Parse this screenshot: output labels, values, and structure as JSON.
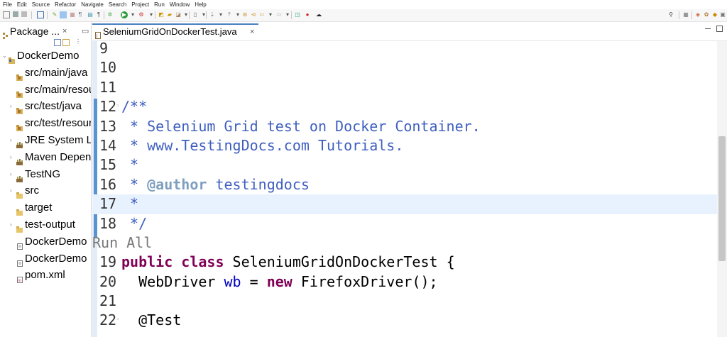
{
  "menu": [
    "File",
    "Edit",
    "Source",
    "Refactor",
    "Navigate",
    "Search",
    "Project",
    "Run",
    "Window",
    "Help"
  ],
  "package_explorer": {
    "tab_label": "Package ...",
    "close_glyph": "×",
    "menu_glyph": "▭",
    "items": [
      {
        "label": "DockerDemo",
        "twisty": "⌄",
        "icon": "project-icon",
        "indent": 0
      },
      {
        "label": "src/main/java",
        "twisty": "",
        "icon": "package-folder-icon",
        "indent": 1
      },
      {
        "label": "src/main/resources",
        "twisty": "",
        "icon": "package-folder-icon",
        "indent": 1
      },
      {
        "label": "src/test/java",
        "twisty": "›",
        "icon": "package-folder-icon",
        "indent": 1
      },
      {
        "label": "src/test/resources",
        "twisty": "",
        "icon": "package-folder-icon",
        "indent": 1
      },
      {
        "label": "JRE System Library",
        "twisty": "›",
        "icon": "library-icon",
        "indent": 1
      },
      {
        "label": "Maven Dependencies",
        "twisty": "›",
        "icon": "library-icon",
        "indent": 1
      },
      {
        "label": "TestNG",
        "twisty": "›",
        "icon": "library-icon",
        "indent": 1
      },
      {
        "label": "src",
        "twisty": "›",
        "icon": "folder-icon",
        "indent": 1
      },
      {
        "label": "target",
        "twisty": "",
        "icon": "folder-icon",
        "indent": 1
      },
      {
        "label": "test-output",
        "twisty": "›",
        "icon": "folder-icon",
        "indent": 1
      },
      {
        "label": "DockerDemo",
        "twisty": "",
        "icon": "file-icon",
        "indent": 1
      },
      {
        "label": "DockerDemo",
        "twisty": "",
        "icon": "file-icon",
        "indent": 1
      },
      {
        "label": "pom.xml",
        "twisty": "",
        "icon": "xml-file-icon",
        "indent": 1
      }
    ]
  },
  "editor": {
    "tab_label": "SeleniumGridOnDockerTest.java",
    "close_glyph": "×",
    "lines": [
      {
        "num": "9",
        "fold": "",
        "parts": []
      },
      {
        "num": "10",
        "fold": "",
        "parts": []
      },
      {
        "num": "11",
        "fold": "",
        "parts": []
      },
      {
        "num": "12",
        "fold": "◦",
        "parts": [
          {
            "t": "/**",
            "c": "cm"
          }
        ]
      },
      {
        "num": "13",
        "fold": "",
        "parts": [
          {
            "t": " * Selenium Grid test on Docker Container.",
            "c": "cm"
          }
        ]
      },
      {
        "num": "14",
        "fold": "",
        "parts": [
          {
            "t": " * www.TestingDocs.com Tutorials.",
            "c": "cm"
          }
        ]
      },
      {
        "num": "15",
        "fold": "",
        "parts": [
          {
            "t": " *",
            "c": "cm"
          }
        ]
      },
      {
        "num": "16",
        "fold": "",
        "parts": [
          {
            "t": " * ",
            "c": "cm"
          },
          {
            "t": "@author",
            "c": "ct"
          },
          {
            "t": " testingdocs",
            "c": "cm"
          }
        ]
      },
      {
        "num": "17",
        "fold": "",
        "current": true,
        "parts": [
          {
            "t": " *",
            "c": "cm"
          }
        ]
      },
      {
        "num": "18",
        "fold": "",
        "parts": [
          {
            "t": " */",
            "c": "cm"
          }
        ]
      },
      {
        "num": "",
        "fold": "",
        "lens": true,
        "parts": [
          {
            "t": "Run All",
            "c": "lens"
          }
        ]
      },
      {
        "num": "19",
        "fold": "",
        "parts": [
          {
            "t": "public",
            "c": "kw"
          },
          {
            "t": " "
          },
          {
            "t": "class",
            "c": "kw"
          },
          {
            "t": " SeleniumGridOnDockerTest {"
          }
        ]
      },
      {
        "num": "20",
        "fold": "",
        "parts": [
          {
            "t": "  WebDriver "
          },
          {
            "t": "wb",
            "c": "fld"
          },
          {
            "t": " = "
          },
          {
            "t": "new",
            "c": "kw"
          },
          {
            "t": " FirefoxDriver();"
          }
        ]
      },
      {
        "num": "21",
        "fold": "",
        "parts": []
      },
      {
        "num": "22",
        "fold": "◦",
        "parts": [
          {
            "t": "  @Test"
          }
        ]
      }
    ]
  }
}
